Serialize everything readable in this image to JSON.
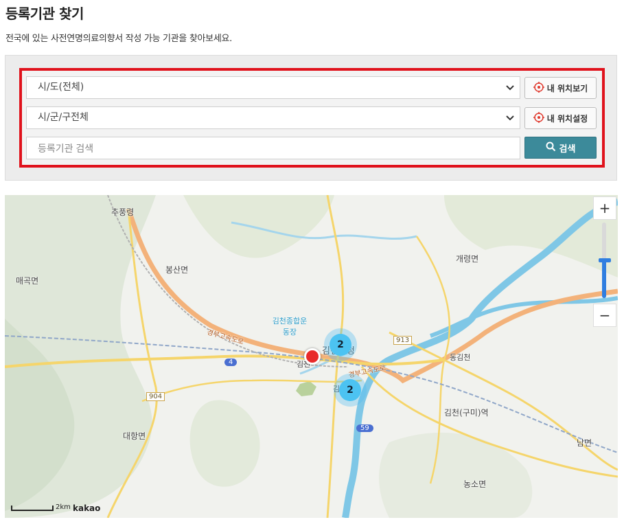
{
  "page": {
    "title": "등록기관 찾기",
    "subtitle": "전국에 있는 사전연명의료의향서 작성 가능 기관을 찾아보세요."
  },
  "search": {
    "province_select": "시/도(전체)",
    "city_select": "시/군/구전체",
    "my_location_view": "내 위치보기",
    "my_location_set": "내 위치설정",
    "keyword_placeholder": "등록기관 검색",
    "search_label": "검색"
  },
  "map": {
    "place_labels": [
      "추풍령",
      "봉산면",
      "매곡면",
      "김천종합운동장",
      "김천",
      "김천시청",
      "개령면",
      "동김천",
      "김천(구미)역",
      "대항면",
      "남면",
      "농소면",
      "김천역",
      "경부고속도로",
      "경부고속도로"
    ],
    "road_numbers": [
      "4",
      "904",
      "913",
      "59"
    ],
    "clusters": [
      {
        "count": "2"
      },
      {
        "count": "2"
      }
    ],
    "zoom_in": "+",
    "zoom_out": "−",
    "zoom_level_fraction": 0.5,
    "scale_label": "2km",
    "attribution": "kakao"
  },
  "colors": {
    "highlight_border": "#e0121c",
    "search_button": "#3c8a9a",
    "cluster": "#4cc3f2",
    "marker": "#e82a2a",
    "river": "#7fc7e6",
    "expressway": "#f3b27a",
    "road": "#f5d56b"
  },
  "icons": {
    "locate": "crosshair-icon",
    "search": "magnifier-icon",
    "dropdown": "chevron-down-icon"
  }
}
